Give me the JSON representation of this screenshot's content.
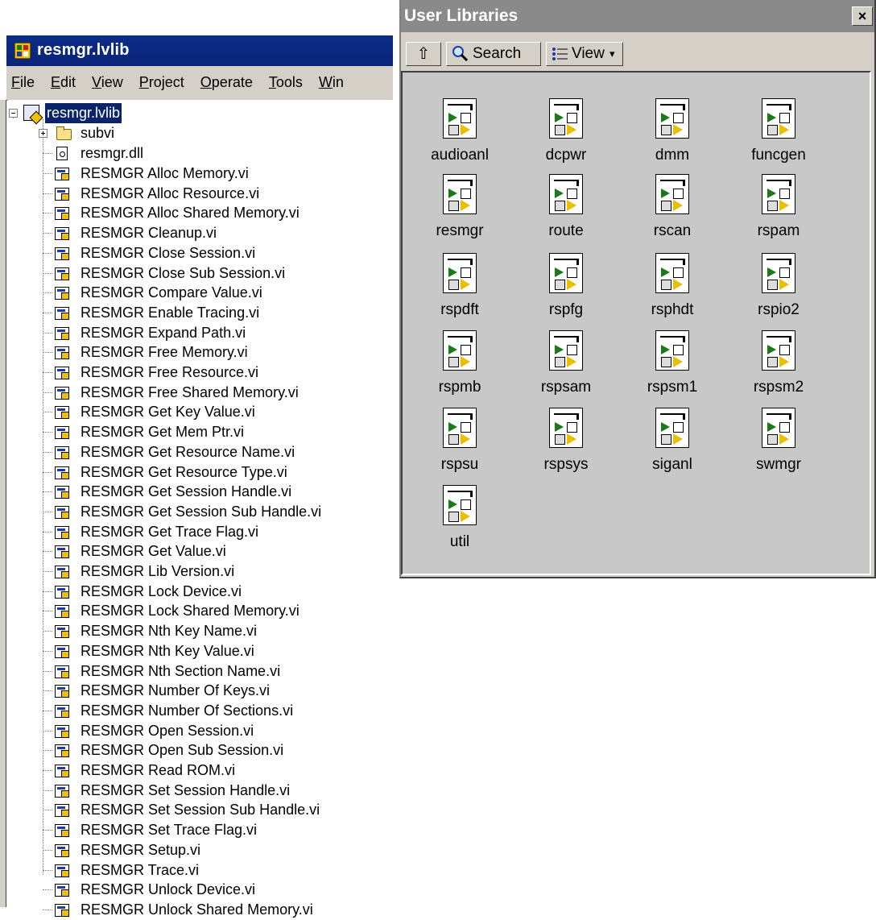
{
  "project_window": {
    "title": "resmgr.lvlib",
    "menu": [
      "File",
      "Edit",
      "View",
      "Project",
      "Operate",
      "Tools",
      "Win"
    ],
    "tree": {
      "root": "resmgr.lvlib",
      "folder": "subvi",
      "dll": "resmgr.dll",
      "vis": [
        "RESMGR Alloc Memory.vi",
        "RESMGR Alloc Resource.vi",
        "RESMGR Alloc Shared Memory.vi",
        "RESMGR Cleanup.vi",
        "RESMGR Close Session.vi",
        "RESMGR Close Sub Session.vi",
        "RESMGR Compare Value.vi",
        "RESMGR Enable Tracing.vi",
        "RESMGR Expand Path.vi",
        "RESMGR Free Memory.vi",
        "RESMGR Free Resource.vi",
        "RESMGR Free Shared Memory.vi",
        "RESMGR Get Key Value.vi",
        "RESMGR Get Mem Ptr.vi",
        "RESMGR Get Resource Name.vi",
        "RESMGR Get Resource Type.vi",
        "RESMGR Get Session Handle.vi",
        "RESMGR Get Session Sub Handle.vi",
        "RESMGR Get Trace Flag.vi",
        "RESMGR Get Value.vi",
        "RESMGR Lib Version.vi",
        "RESMGR Lock Device.vi",
        "RESMGR Lock Shared Memory.vi",
        "RESMGR Nth Key Name.vi",
        "RESMGR Nth Key Value.vi",
        "RESMGR Nth Section Name.vi",
        "RESMGR Number Of Keys.vi",
        "RESMGR Number Of Sections.vi",
        "RESMGR Open Session.vi",
        "RESMGR Open Sub Session.vi",
        "RESMGR Read ROM.vi",
        "RESMGR Set Session Handle.vi",
        "RESMGR Set Session Sub Handle.vi",
        "RESMGR Set Trace Flag.vi",
        "RESMGR Setup.vi",
        "RESMGR Trace.vi",
        "RESMGR Unlock Device.vi",
        "RESMGR Unlock Shared Memory.vi"
      ]
    }
  },
  "palette_window": {
    "title": "User Libraries",
    "close_glyph": "×",
    "toolbar": {
      "up_glyph": "⇧",
      "search_label": "Search",
      "view_label": "View",
      "view_arrow": "▾"
    },
    "items": [
      "audioanl",
      "dcpwr",
      "dmm",
      "funcgen",
      "resmgr",
      "route",
      "rscan",
      "rspam",
      "rspdft",
      "rspfg",
      "rsphdt",
      "rspio2",
      "rspmb",
      "rspsam",
      "rspsm1",
      "rspsm2",
      "rspsu",
      "rspsys",
      "siganl",
      "swmgr",
      "util"
    ]
  },
  "icons": {
    "project_app": "labview-project-icon",
    "library": "library-icon",
    "folder": "folder-icon",
    "dll": "dll-file-icon",
    "vi": "vi-file-icon",
    "palette_item": "vi-subpalette-icon",
    "up": "up-arrow-icon",
    "search": "magnifier-icon",
    "view": "view-options-icon"
  }
}
